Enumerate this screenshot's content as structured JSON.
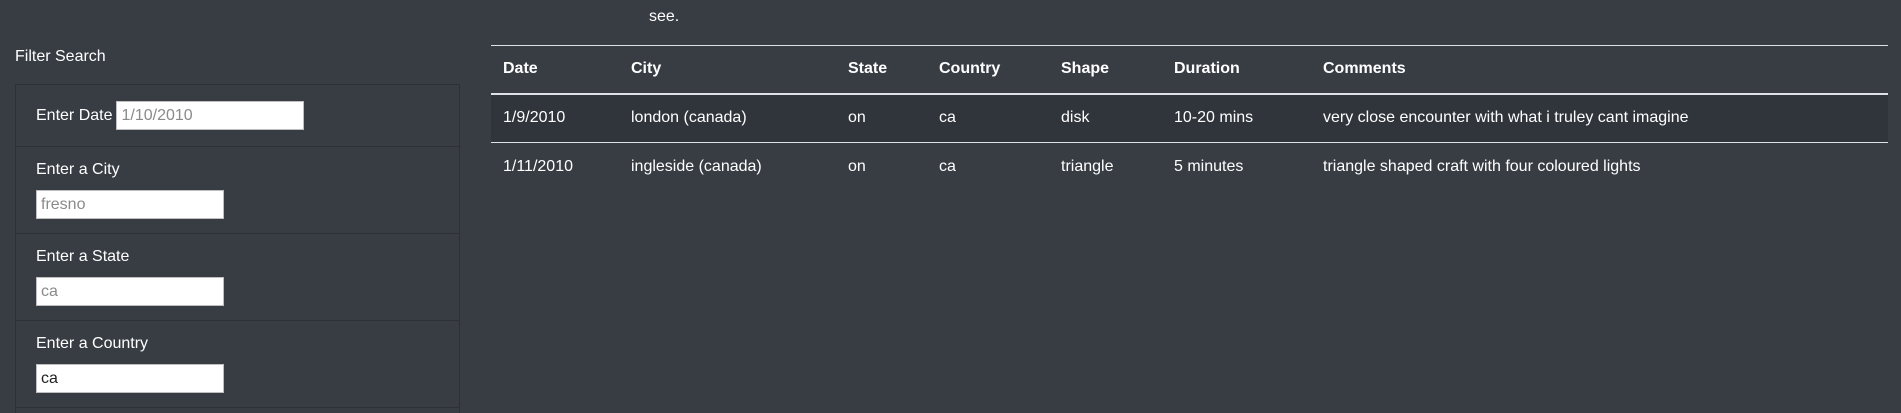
{
  "intro": {
    "trailing_text": "see."
  },
  "filter": {
    "title": "Filter Search",
    "date": {
      "label": "Enter Date",
      "placeholder": "1/10/2010",
      "value": ""
    },
    "city": {
      "label": "Enter a City",
      "placeholder": "fresno",
      "value": ""
    },
    "state": {
      "label": "Enter a State",
      "placeholder": "ca",
      "value": ""
    },
    "country": {
      "label": "Enter a Country",
      "placeholder": "",
      "value": "ca"
    }
  },
  "table": {
    "headers": [
      "Date",
      "City",
      "State",
      "Country",
      "Shape",
      "Duration",
      "Comments"
    ],
    "rows": [
      [
        "1/9/2010",
        "london (canada)",
        "on",
        "ca",
        "disk",
        "10-20 mins",
        "very close encounter with what i truley cant imagine"
      ],
      [
        "1/11/2010",
        "ingleside (canada)",
        "on",
        "ca",
        "triangle",
        "5 minutes",
        "triangle shaped craft with four coloured lights"
      ]
    ]
  },
  "colors": {
    "background": "#383d44",
    "stripe": "#30353b",
    "border": "#dee2e6",
    "text": "#ffffff"
  }
}
